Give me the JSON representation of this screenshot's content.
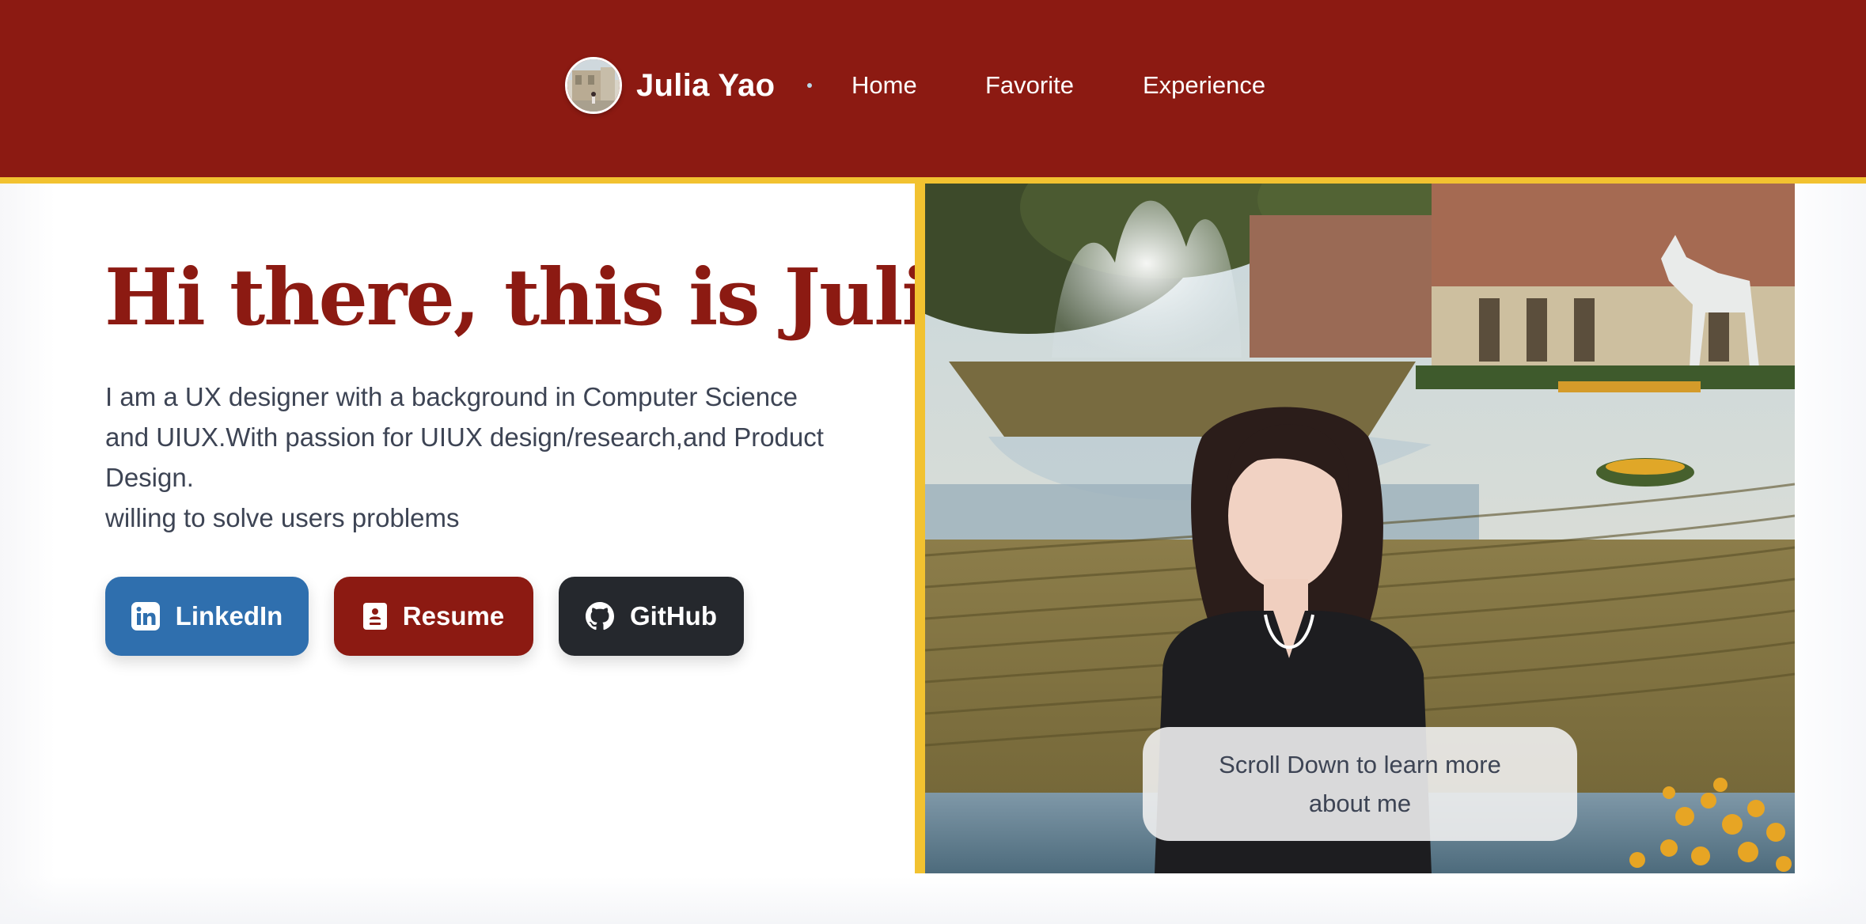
{
  "header": {
    "avatar_alt": "avatar",
    "brand_name": "Julia Yao",
    "nav": {
      "home": "Home",
      "favorite": "Favorite",
      "experience": "Experience"
    }
  },
  "hero": {
    "title": "Hi there, this is Julia",
    "description_lines": [
      "I am a UX designer with a background in Computer Science",
      "and UIUX.With passion for UIUX design/research,and Product",
      "Design.",
      "willing to solve users problems"
    ],
    "buttons": {
      "linkedin": "LinkedIn",
      "resume": "Resume",
      "github": "GitHub"
    },
    "scroll_hint": "Scroll Down to learn more about me"
  },
  "colors": {
    "brand_red": "#8c1a12",
    "gold_accent": "#f2c230",
    "linkedin_blue": "#2f6fae",
    "github_dark": "#25282d",
    "body_text": "#3d4454"
  },
  "icons": {
    "linkedin": "linkedin-icon",
    "resume": "resume-icon",
    "github": "github-icon"
  }
}
